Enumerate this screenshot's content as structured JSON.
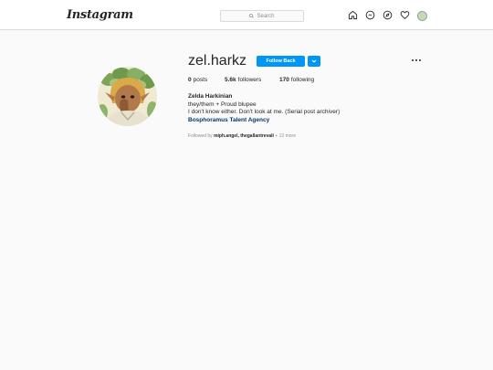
{
  "header": {
    "logo": "Instagram",
    "search_placeholder": "Search",
    "nav_icons": [
      "home-icon",
      "messenger-icon",
      "explore-icon",
      "heart-icon",
      "profile-avatar"
    ]
  },
  "profile": {
    "username": "zel.harkz",
    "follow_label": "Follow Back",
    "stats": {
      "posts_count": "0",
      "posts_label": "posts",
      "followers_count": "5.6k",
      "followers_label": "followers",
      "following_count": "170",
      "following_label": "following"
    },
    "bio": {
      "full_name": "Zelda Harkinian",
      "line1": "they/them + Proud blupee",
      "line2": "I don't know either. Don't look at me. (Serial post archiver)",
      "link": "Bosphoramus Talent Agency"
    },
    "followed_by": {
      "prefix": "Followed by",
      "users": "miph.angel, thegallantrevali",
      "suffix": "+ 12 more"
    }
  },
  "colors": {
    "accent": "#0095f6",
    "link": "#00376b",
    "background": "#fafafa"
  }
}
